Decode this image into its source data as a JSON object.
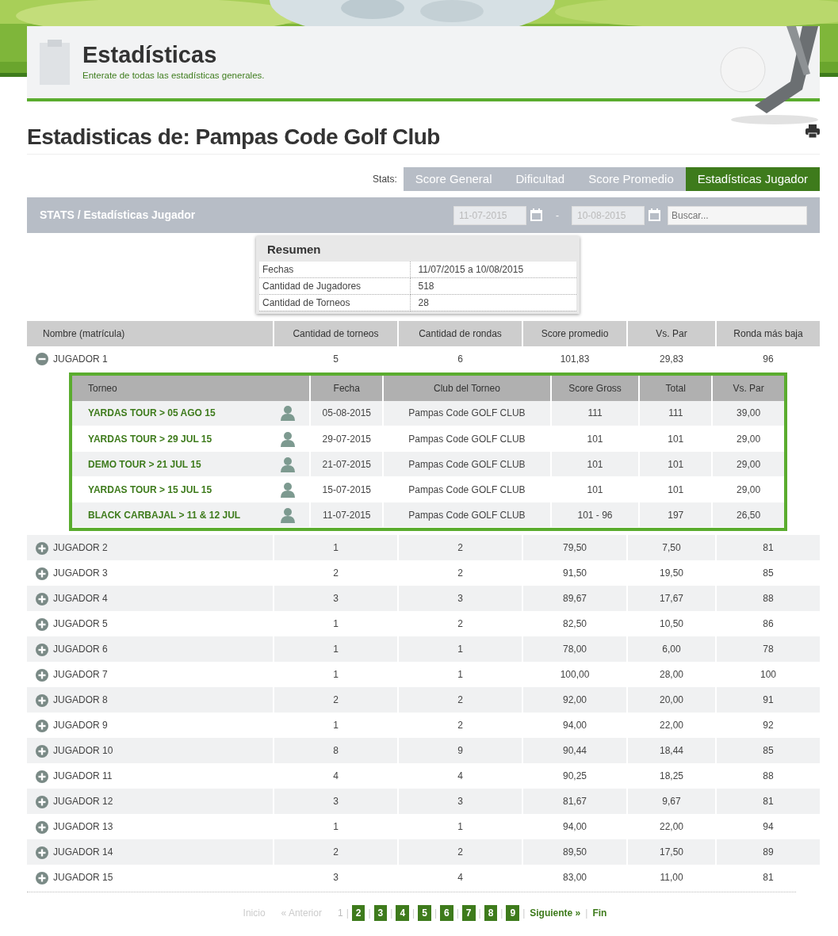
{
  "header": {
    "title": "Estadísticas",
    "subtitle": "Enterate de todas las estadísticas generales."
  },
  "page_title": "Estadisticas de: Pampas Code Golf Club",
  "stats_label": "Stats:",
  "tabs": [
    {
      "label": "Score General",
      "selected": false
    },
    {
      "label": "Dificultad",
      "selected": false
    },
    {
      "label": "Score Promedio",
      "selected": false
    },
    {
      "label": "Estadísticas Jugador",
      "selected": true
    }
  ],
  "toolbar": {
    "breadcrumb": "STATS / Estadísticas Jugador",
    "date_from": "11-07-2015",
    "separator": "-",
    "date_to": "10-08-2015",
    "search": {
      "placeholder": "Buscar..."
    }
  },
  "summary": {
    "title": "Resumen",
    "rows": [
      {
        "label": "Fechas",
        "value": "11/07/2015 a 10/08/2015"
      },
      {
        "label": "Cantidad de Jugadores",
        "value": "518"
      },
      {
        "label": "Cantidad de Torneos",
        "value": "28"
      }
    ]
  },
  "table": {
    "columns": [
      "Nombre (matrícula)",
      "Cantidad de torneos",
      "Cantidad de rondas",
      "Score promedio",
      "Vs. Par",
      "Ronda más baja"
    ],
    "detail_columns": [
      "Torneo",
      "Fecha",
      "Club del Torneo",
      "Score Gross",
      "Total",
      "Vs. Par"
    ],
    "rows": [
      {
        "cells": [
          "JUGADOR 1",
          "5",
          "6",
          "101,83",
          "29,83",
          "96"
        ],
        "expanded": true,
        "details": [
          {
            "torneo": "YARDAS TOUR > 05 AGO 15",
            "fecha": "05-08-2015",
            "club": "Pampas Code GOLF CLUB",
            "gross": "111",
            "total": "111",
            "vs_par": "39,00"
          },
          {
            "torneo": "YARDAS TOUR > 29 JUL 15",
            "fecha": "29-07-2015",
            "club": "Pampas Code GOLF CLUB",
            "gross": "101",
            "total": "101",
            "vs_par": "29,00"
          },
          {
            "torneo": "DEMO TOUR > 21 JUL 15",
            "fecha": "21-07-2015",
            "club": "Pampas Code GOLF CLUB",
            "gross": "101",
            "total": "101",
            "vs_par": "29,00"
          },
          {
            "torneo": "YARDAS TOUR > 15 JUL 15",
            "fecha": "15-07-2015",
            "club": "Pampas Code GOLF CLUB",
            "gross": "101",
            "total": "101",
            "vs_par": "29,00"
          },
          {
            "torneo": "BLACK CARBAJAL > 11 & 12 JUL",
            "fecha": "11-07-2015",
            "club": "Pampas Code GOLF CLUB",
            "gross": "101 - 96",
            "total": "197",
            "vs_par": "26,50"
          }
        ]
      },
      {
        "cells": [
          "JUGADOR 2",
          "1",
          "2",
          "79,50",
          "7,50",
          "81"
        ],
        "expanded": false
      },
      {
        "cells": [
          "JUGADOR 3",
          "2",
          "2",
          "91,50",
          "19,50",
          "85"
        ],
        "expanded": false
      },
      {
        "cells": [
          "JUGADOR 4",
          "3",
          "3",
          "89,67",
          "17,67",
          "88"
        ],
        "expanded": false
      },
      {
        "cells": [
          "JUGADOR 5",
          "1",
          "2",
          "82,50",
          "10,50",
          "86"
        ],
        "expanded": false
      },
      {
        "cells": [
          "JUGADOR 6",
          "1",
          "1",
          "78,00",
          "6,00",
          "78"
        ],
        "expanded": false
      },
      {
        "cells": [
          "JUGADOR 7",
          "1",
          "1",
          "100,00",
          "28,00",
          "100"
        ],
        "expanded": false
      },
      {
        "cells": [
          "JUGADOR 8",
          "2",
          "2",
          "92,00",
          "20,00",
          "91"
        ],
        "expanded": false
      },
      {
        "cells": [
          "JUGADOR 9",
          "1",
          "2",
          "94,00",
          "22,00",
          "92"
        ],
        "expanded": false
      },
      {
        "cells": [
          "JUGADOR 10",
          "8",
          "9",
          "90,44",
          "18,44",
          "85"
        ],
        "expanded": false
      },
      {
        "cells": [
          "JUGADOR 11",
          "4",
          "4",
          "90,25",
          "18,25",
          "88"
        ],
        "expanded": false
      },
      {
        "cells": [
          "JUGADOR 12",
          "3",
          "3",
          "81,67",
          "9,67",
          "81"
        ],
        "expanded": false
      },
      {
        "cells": [
          "JUGADOR 13",
          "1",
          "1",
          "94,00",
          "22,00",
          "94"
        ],
        "expanded": false
      },
      {
        "cells": [
          "JUGADOR 14",
          "2",
          "2",
          "89,50",
          "17,50",
          "89"
        ],
        "expanded": false
      },
      {
        "cells": [
          "JUGADOR 15",
          "3",
          "4",
          "83,00",
          "11,00",
          "81"
        ],
        "expanded": false
      }
    ]
  },
  "pagination": {
    "first": {
      "label": "Inicio",
      "disabled": true
    },
    "prev": {
      "label": "« Anterior",
      "disabled": true
    },
    "pages": [
      {
        "label": "1",
        "selected": true
      },
      {
        "label": "2",
        "selected": false
      },
      {
        "label": "3",
        "selected": false
      },
      {
        "label": "4",
        "selected": false
      },
      {
        "label": "5",
        "selected": false
      },
      {
        "label": "6",
        "selected": false
      },
      {
        "label": "7",
        "selected": false
      },
      {
        "label": "8",
        "selected": false
      },
      {
        "label": "9",
        "selected": false
      }
    ],
    "separator": "|",
    "next": {
      "label": "Siguiente »",
      "disabled": false
    },
    "last": {
      "label": "Fin",
      "disabled": false
    }
  }
}
